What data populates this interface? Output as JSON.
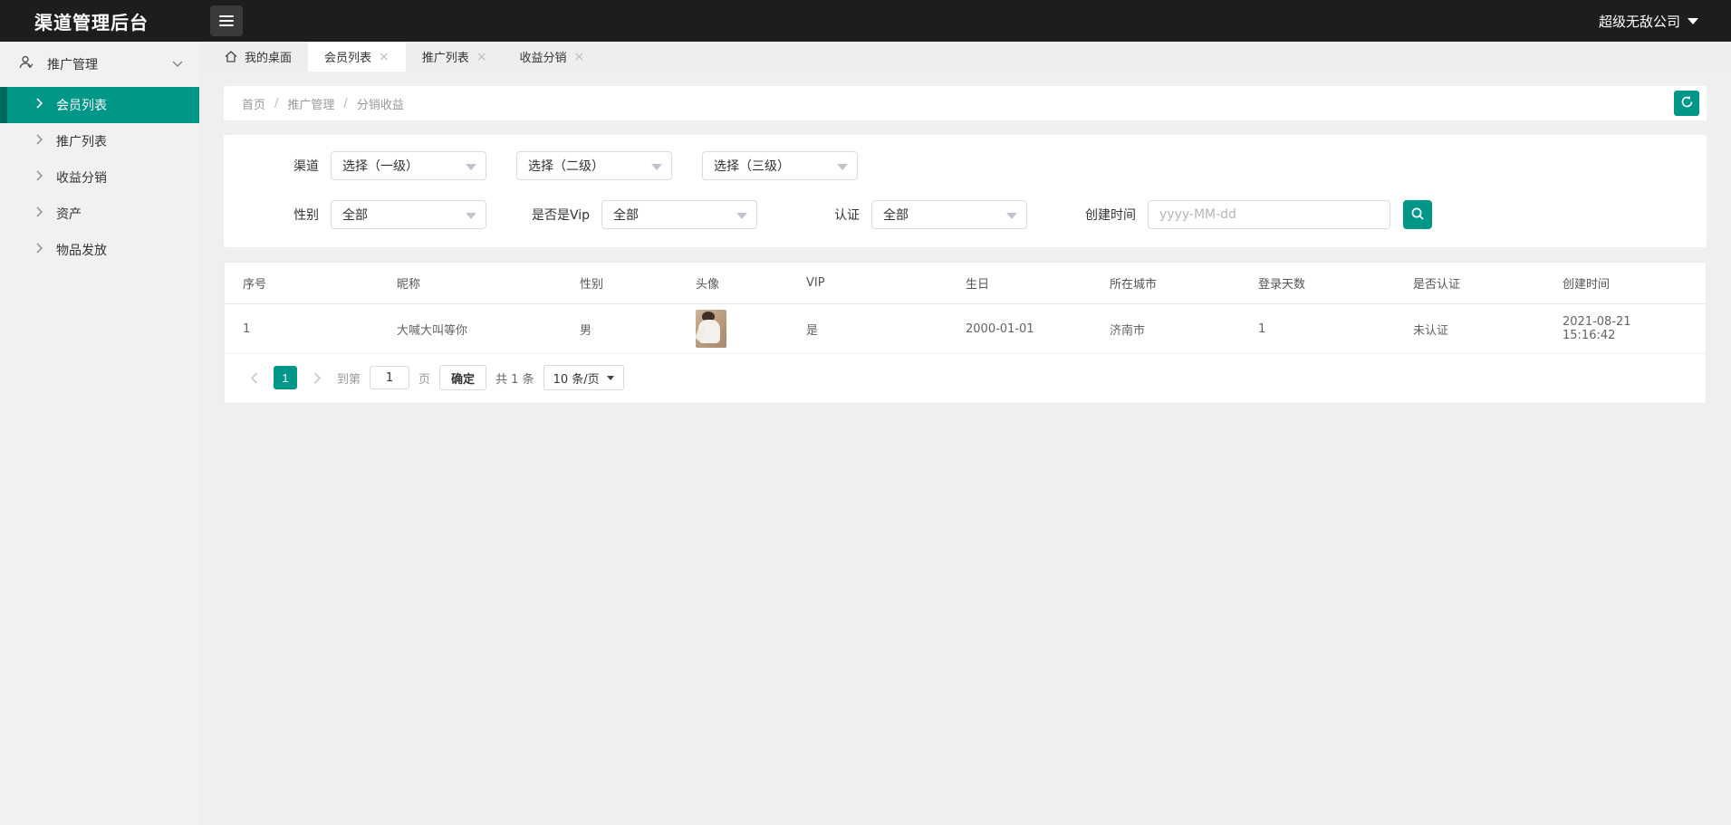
{
  "app": {
    "title": "渠道管理后台",
    "company": "超级无敌公司"
  },
  "ui": {
    "close_glyph": "×"
  },
  "sidebar": {
    "group_label": "推广管理",
    "items": [
      {
        "label": "会员列表",
        "active": true
      },
      {
        "label": "推广列表",
        "active": false
      },
      {
        "label": "收益分销",
        "active": false
      },
      {
        "label": "资产",
        "active": false
      },
      {
        "label": "物品发放",
        "active": false
      }
    ]
  },
  "tabs": [
    {
      "label": "我的桌面",
      "icon": "home-icon",
      "closable": false,
      "active": false
    },
    {
      "label": "会员列表",
      "closable": true,
      "active": true
    },
    {
      "label": "推广列表",
      "closable": true,
      "active": false
    },
    {
      "label": "收益分销",
      "closable": true,
      "active": false
    }
  ],
  "breadcrumb": {
    "separator": "/",
    "items": [
      "首页",
      "推广管理",
      "分销收益"
    ]
  },
  "filters": {
    "channel": {
      "label": "渠道",
      "selects": [
        "选择（一级）",
        "选择（二级）",
        "选择（三级）"
      ]
    },
    "row2": [
      {
        "label": "性别",
        "value": "全部"
      },
      {
        "label": "是否是Vip",
        "value": "全部"
      },
      {
        "label": "认证",
        "value": "全部"
      }
    ],
    "date": {
      "label": "创建时间",
      "placeholder": "yyyy-MM-dd"
    }
  },
  "table": {
    "columns": [
      "序号",
      "昵称",
      "性别",
      "头像",
      "VIP",
      "生日",
      "所在城市",
      "登录天数",
      "是否认证",
      "创建时间"
    ],
    "rows": [
      {
        "index": "1",
        "nickname": "大喊大叫等你",
        "gender": "男",
        "vip": "是",
        "birthday": "2000-01-01",
        "city": "济南市",
        "login_days": "1",
        "verified": "未认证",
        "created_at": "2021-08-21 15:16:42"
      }
    ]
  },
  "pagination": {
    "current_page": "1",
    "goto_label": "到第",
    "goto_value": "1",
    "page_unit_label": "页",
    "confirm_label": "确定",
    "total_label": "共 1 条",
    "page_size_label": "10 条/页"
  },
  "colors": {
    "accent": "#009688",
    "accent_dark": "#00695f",
    "header_bg": "#1d1d1d"
  }
}
